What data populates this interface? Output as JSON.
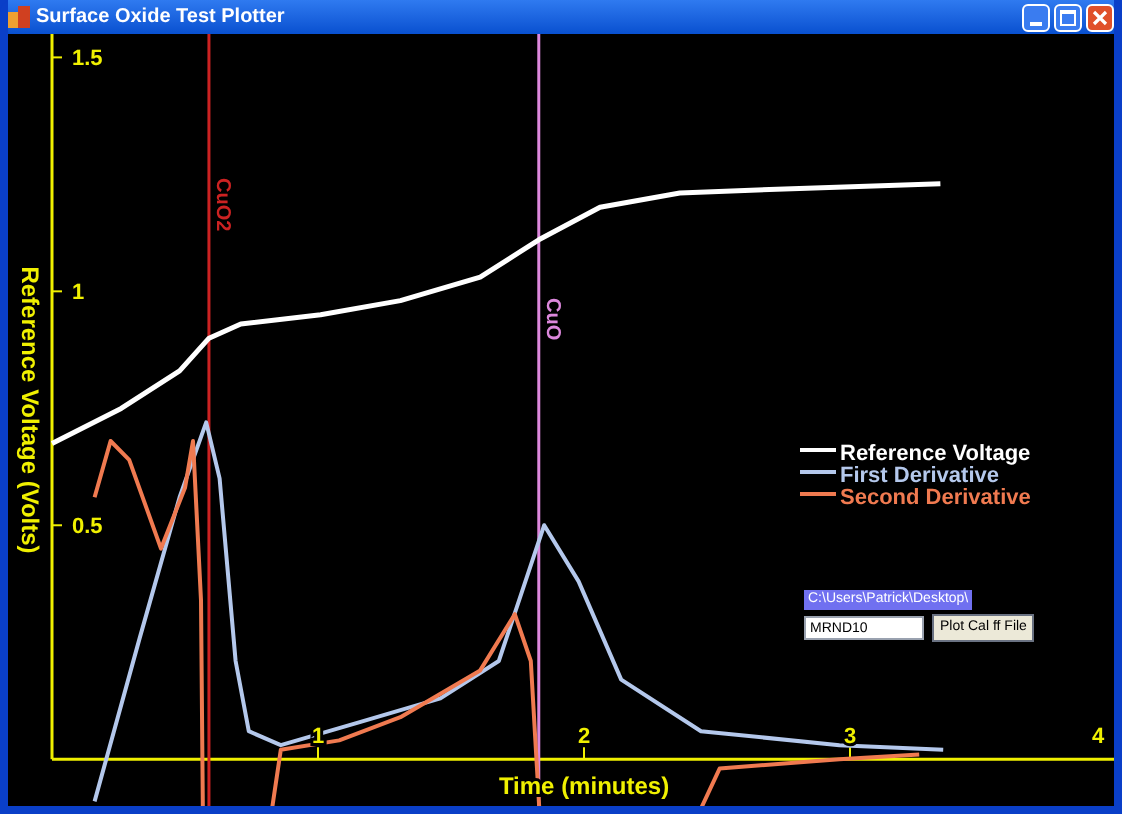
{
  "window": {
    "title": "Surface Oxide Test Plotter"
  },
  "plot": {
    "chart_data": {
      "type": "line",
      "legend": true,
      "xlabel": "Time (minutes)",
      "ylabel": "Reference Voltage (Volts)",
      "xlim": [
        0,
        4
      ],
      "ylim": [
        -0.1,
        1.55
      ],
      "xticks": [
        1,
        2,
        3,
        4
      ],
      "yticks": [
        0.5,
        1,
        1.5
      ],
      "series": [
        {
          "name": "Reference Voltage",
          "color": "#ffffff",
          "x": [
            0,
            0.26,
            0.48,
            0.59,
            0.71,
            1.01,
            1.31,
            1.61,
            1.83,
            2.06,
            2.36,
            2.81,
            3.34
          ],
          "values": [
            0.675,
            0.75,
            0.83,
            0.9,
            0.93,
            0.95,
            0.98,
            1.03,
            1.11,
            1.18,
            1.21,
            1.22,
            1.23
          ]
        },
        {
          "name": "First Derivative",
          "color": "#b4c8ec",
          "x": [
            0.16,
            0.33,
            0.48,
            0.58,
            0.63,
            0.69,
            0.74,
            0.86,
            1.16,
            1.46,
            1.68,
            1.85,
            1.98,
            2.14,
            2.44,
            2.96,
            3.35
          ],
          "values": [
            -0.09,
            0.26,
            0.56,
            0.72,
            0.6,
            0.21,
            0.06,
            0.03,
            0.08,
            0.13,
            0.21,
            0.5,
            0.38,
            0.17,
            0.06,
            0.03,
            0.02
          ]
        },
        {
          "name": "Second Derivative",
          "color": "#f07a50",
          "x": [
            0.16,
            0.22,
            0.29,
            0.41,
            0.5,
            0.53,
            0.56,
            0.57,
            0.78,
            0.86,
            1.08,
            1.31,
            1.61,
            1.74,
            1.8,
            1.85,
            2.29,
            2.51,
            2.96,
            3.26
          ],
          "values": [
            0.56,
            0.68,
            0.64,
            0.45,
            0.58,
            0.68,
            0.34,
            null,
            null,
            0.02,
            0.04,
            0.09,
            0.19,
            0.31,
            0.21,
            null,
            null,
            -0.02,
            0,
            0.01
          ]
        }
      ],
      "ref_lines": [
        {
          "axis": "x",
          "value": 0.59,
          "label": "CuO2",
          "color": "#cc2222"
        },
        {
          "axis": "x",
          "value": 1.83,
          "label": "CuO",
          "color": "#dd88dd"
        }
      ]
    }
  },
  "file_path": "C:\\Users\\Patrick\\Desktop\\",
  "run_field": {
    "value": "MRND10"
  },
  "plot_button": "Plot Cal ff File"
}
